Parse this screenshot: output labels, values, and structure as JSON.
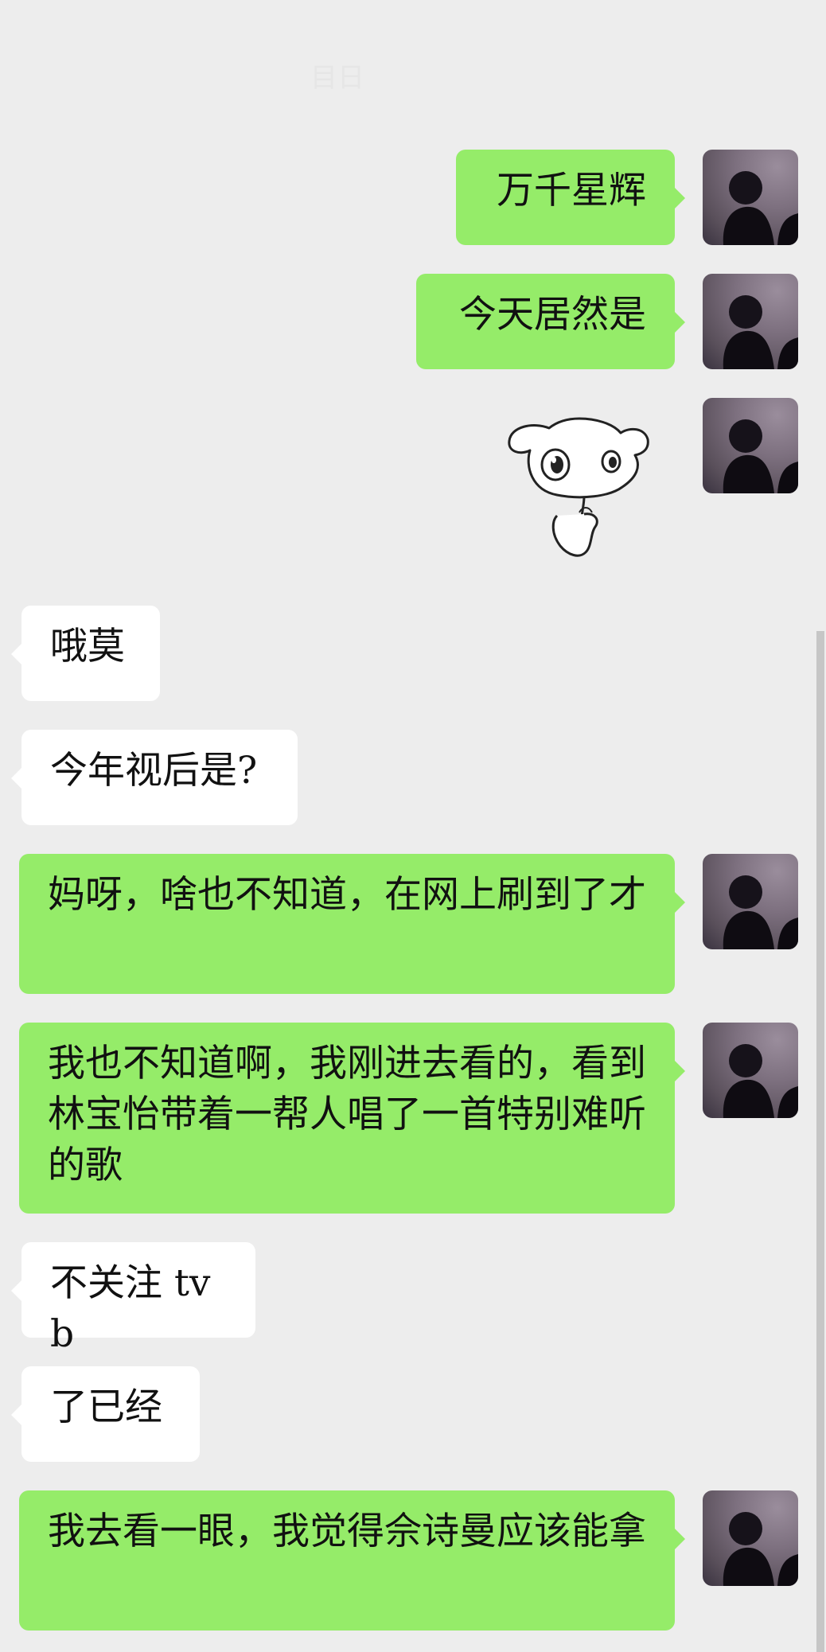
{
  "header": {
    "title": "目日"
  },
  "messages": [
    {
      "side": "sent",
      "text": "万千星辉",
      "avatar_icon": "user-avatar-icon"
    },
    {
      "side": "sent",
      "text": "今天居然是",
      "avatar_icon": "user-avatar-icon"
    },
    {
      "side": "sent",
      "sticker_icon": "cartoon-dog-sticker-icon",
      "avatar_icon": "user-avatar-icon"
    },
    {
      "side": "received",
      "text": "哦莫"
    },
    {
      "side": "received",
      "text": "今年视后是?"
    },
    {
      "side": "sent",
      "text": "妈呀，啥也不知道，在网上刷到了才",
      "avatar_icon": "user-avatar-icon"
    },
    {
      "side": "sent",
      "text": "我也不知道啊，我刚进去看的，看到林宝怡带着一帮人唱了一首特别难听的歌",
      "avatar_icon": "user-avatar-icon"
    },
    {
      "side": "received",
      "text": "不关注 tvb"
    },
    {
      "side": "received",
      "text": "了已经"
    },
    {
      "side": "sent",
      "text": "我去看一眼，我觉得佘诗曼应该能拿",
      "avatar_icon": "user-avatar-icon"
    }
  ],
  "colors": {
    "background": "#ededed",
    "sent_bubble": "#95ec69",
    "received_bubble": "#ffffff",
    "text": "#111111"
  }
}
